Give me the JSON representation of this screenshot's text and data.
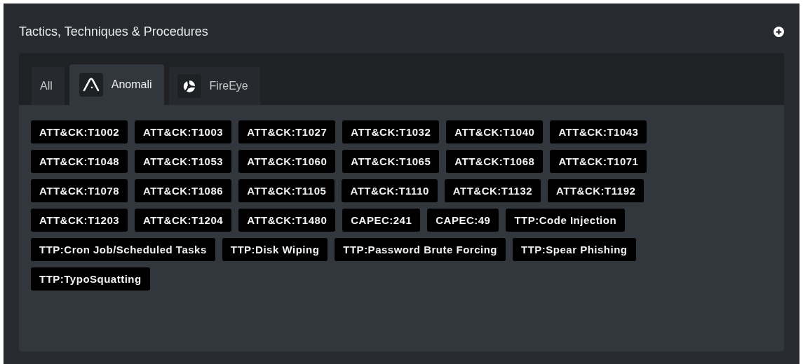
{
  "panel": {
    "title": "Tactics, Techniques & Procedures"
  },
  "tabs": [
    {
      "label": "All",
      "selected": false,
      "kind": "plain"
    },
    {
      "label": "Anomali",
      "selected": true,
      "kind": "arch"
    },
    {
      "label": "FireEye",
      "selected": false,
      "kind": "ring"
    }
  ],
  "tags": [
    "ATT&CK:T1002",
    "ATT&CK:T1003",
    "ATT&CK:T1027",
    "ATT&CK:T1032",
    "ATT&CK:T1040",
    "ATT&CK:T1043",
    "ATT&CK:T1048",
    "ATT&CK:T1053",
    "ATT&CK:T1060",
    "ATT&CK:T1065",
    "ATT&CK:T1068",
    "ATT&CK:T1071",
    "ATT&CK:T1078",
    "ATT&CK:T1086",
    "ATT&CK:T1105",
    "ATT&CK:T1110",
    "ATT&CK:T1132",
    "ATT&CK:T1192",
    "ATT&CK:T1203",
    "ATT&CK:T1204",
    "ATT&CK:T1480",
    "CAPEC:241",
    "CAPEC:49",
    "TTP:Code Injection",
    "TTP:Cron Job/Scheduled Tasks",
    "TTP:Disk Wiping",
    "TTP:Password Brute Forcing",
    "TTP:Spear Phishing",
    "TTP:TypoSquatting"
  ]
}
